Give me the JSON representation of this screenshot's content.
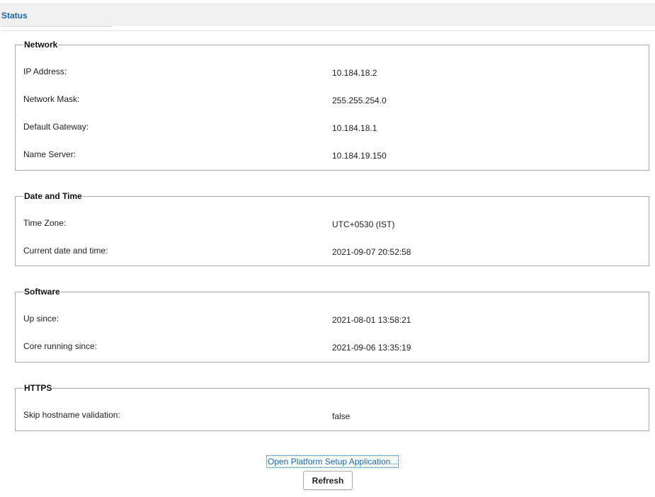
{
  "header": {
    "tab_label": "Status",
    "accent_color": "#1a66a6"
  },
  "sections": {
    "network": {
      "title": "Network",
      "rows": [
        {
          "label": "IP Address:",
          "value": "10.184.18.2"
        },
        {
          "label": "Network Mask:",
          "value": "255.255.254.0"
        },
        {
          "label": "Default Gateway:",
          "value": "10.184.18.1"
        },
        {
          "label": "Name Server:",
          "value": "10.184.19.150"
        }
      ]
    },
    "datetime": {
      "title": "Date and Time",
      "rows": [
        {
          "label": "Time Zone:",
          "value": "UTC+0530 (IST)"
        },
        {
          "label": "Current date and time:",
          "value": "2021-09-07 20:52:58"
        }
      ]
    },
    "software": {
      "title": "Software",
      "rows": [
        {
          "label": "Up since:",
          "value": "2021-08-01 13:58:21"
        },
        {
          "label": "Core running since:",
          "value": "2021-09-06 13:35:19"
        }
      ]
    },
    "https": {
      "title": "HTTPS",
      "rows": [
        {
          "label": "Skip hostname validation:",
          "value": "false"
        }
      ]
    }
  },
  "actions": {
    "setup_link_label": "Open Platform Setup Application...",
    "refresh_label": "Refresh"
  }
}
